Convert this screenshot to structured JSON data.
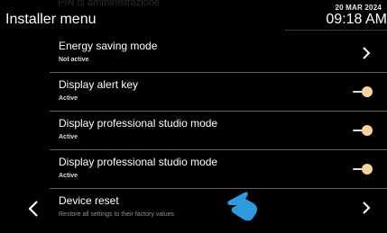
{
  "background_ghost": {
    "pin_label": "PIN di amministrazione"
  },
  "header": {
    "title": "Installer menu",
    "date": "20 MAR 2024",
    "time": "09:18 AM"
  },
  "menu": {
    "items": [
      {
        "title": "Energy saving mode",
        "subtitle": "Not active",
        "control": "chevron"
      },
      {
        "title": "Display alert key",
        "subtitle": "Active",
        "control": "toggle",
        "state": "on"
      },
      {
        "title": "Display professional studio mode",
        "subtitle": "Active",
        "control": "toggle",
        "state": "on"
      },
      {
        "title": "Display professional studio mode",
        "subtitle": "Active",
        "control": "toggle",
        "state": "on"
      },
      {
        "title": "Device reset",
        "subtitle": "Restore all settings to their factory values",
        "control": "chevron"
      }
    ]
  },
  "icons": {
    "back": "chevron-left-icon",
    "row_next": "chevron-right-icon",
    "toggle": "toggle-on-icon",
    "touch_hint": "pointing-hand-icon"
  },
  "colors": {
    "background": "#000000",
    "text": "#ffffff",
    "toggle_knob": "#f7d29a",
    "touch_hint": "#2e9be0",
    "divider": "#5e5e5e"
  }
}
